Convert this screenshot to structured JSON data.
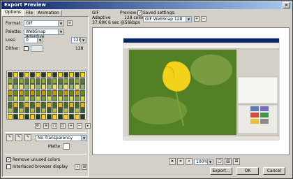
{
  "window": {
    "title": "Export Preview",
    "close_glyph": "×"
  },
  "tabs": [
    {
      "label": "Options",
      "active": true
    },
    {
      "label": "File",
      "active": false
    },
    {
      "label": "Animation",
      "active": false
    }
  ],
  "options": {
    "format_label": "Format:",
    "format_value": "GIF",
    "palette_label": "Palette:",
    "palette_value": "WebSnap Adaptive",
    "loss_label": "Loss:",
    "loss_value": "0",
    "colors_value": "128",
    "dither_label": "Dither:",
    "dither_value": "128",
    "transparency_value": "No Transparency",
    "matte_label": "Matte:",
    "remove_unused_label": "Remove unused colors",
    "remove_unused_checked": true,
    "interlaced_label": "Interlaced browser display",
    "interlaced_checked": false
  },
  "info": {
    "format": "GIF",
    "palette": "Adaptive",
    "size_line": "37.69K 6 sec @56kbps",
    "preview_label": "Preview",
    "colors_line": "128 colors",
    "saved_settings_label": "Saved settings:",
    "saved_settings_value": "GIF WebSnap 128"
  },
  "zoom": {
    "value": "100%"
  },
  "buttons": {
    "export": "Export...",
    "ok": "OK",
    "cancel": "Cancel"
  },
  "colors": {
    "titlebar_start": "#0a246a",
    "titlebar_end": "#a6caf0",
    "flower": "#f2d21a",
    "leaf_bg": "#5f8a2a"
  }
}
